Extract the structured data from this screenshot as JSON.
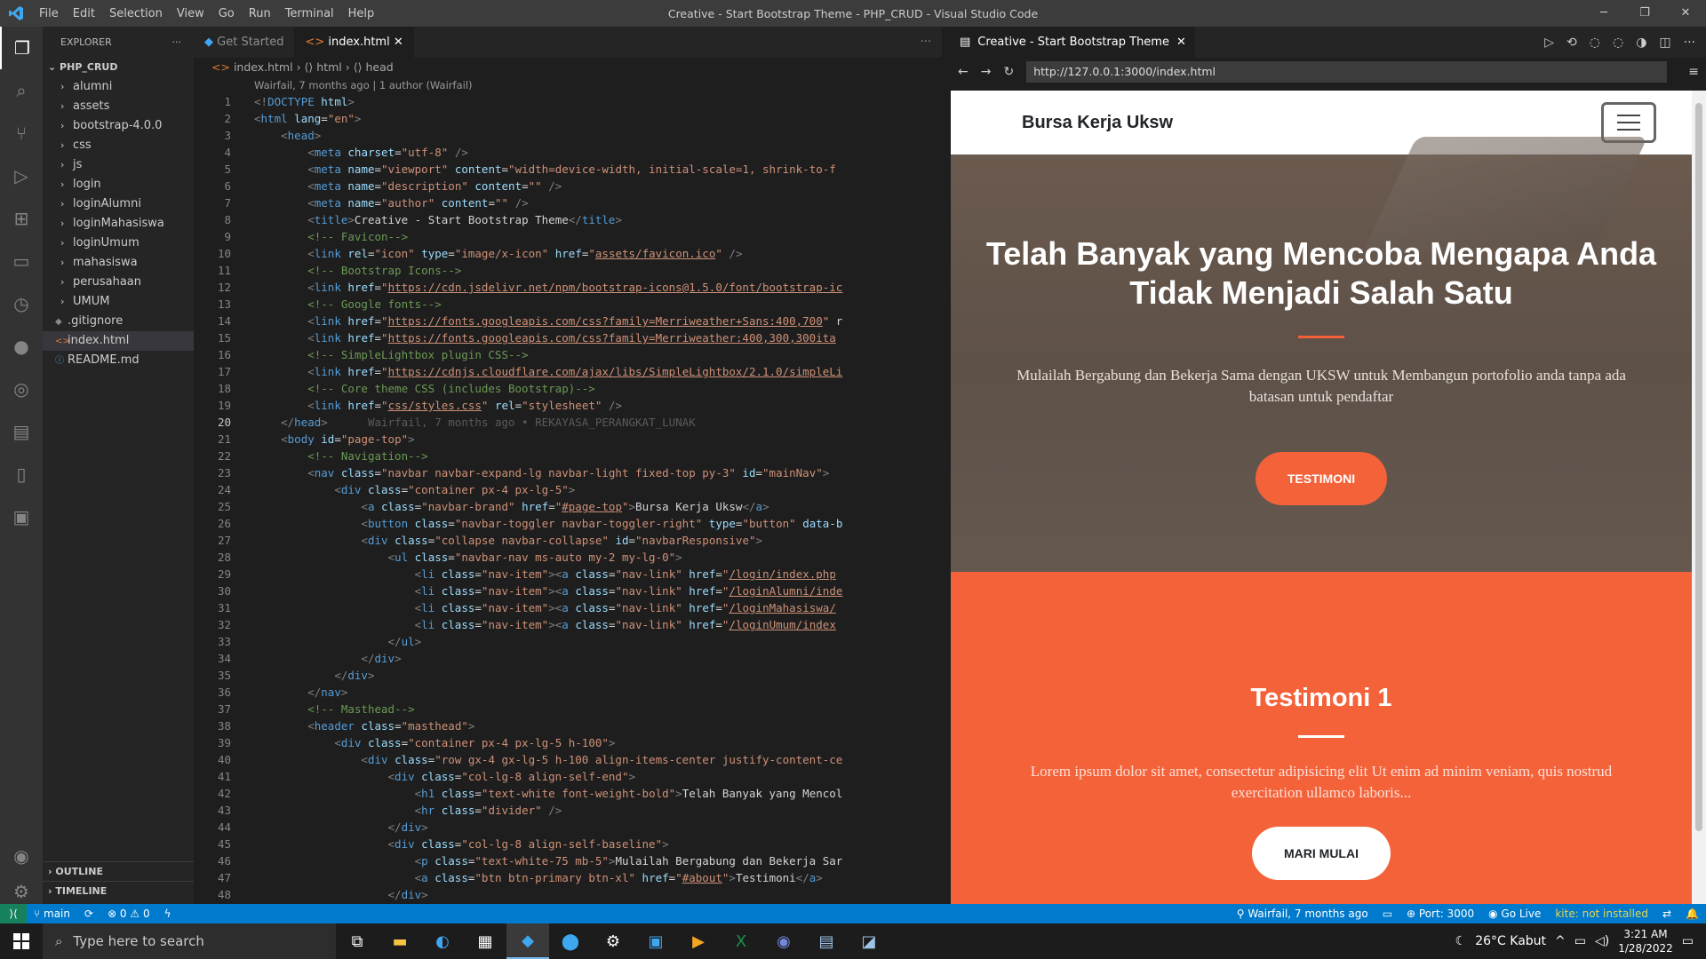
{
  "titlebar": {
    "menu": [
      "File",
      "Edit",
      "Selection",
      "View",
      "Go",
      "Run",
      "Terminal",
      "Help"
    ],
    "title": "Creative - Start Bootstrap Theme - PHP_CRUD - Visual Studio Code"
  },
  "sidebar": {
    "header": "EXPLORER",
    "root": "PHP_CRUD",
    "folders": [
      "alumni",
      "assets",
      "bootstrap-4.0.0",
      "css",
      "js",
      "login",
      "loginAlumni",
      "loginMahasiswa",
      "loginUmum",
      "mahasiswa",
      "perusahaan",
      "UMUM"
    ],
    "files": [
      ".gitignore",
      "index.html",
      "README.md"
    ],
    "outline": "OUTLINE",
    "timeline": "TIMELINE"
  },
  "editor": {
    "tabs": [
      "Get Started",
      "index.html"
    ],
    "breadcrumb": [
      "index.html",
      "html",
      "head"
    ],
    "blame": "Wairfail, 7 months ago | 1 author (Wairfail)",
    "inline_blame": "Wairfail, 7 months ago • REKAYASA_PERANGKAT_LUNAK",
    "current_line": 20,
    "first_line": 1,
    "line_count": 48
  },
  "preview": {
    "tab": "Creative - Start Bootstrap Theme",
    "url": "http://127.0.0.1:3000/index.html",
    "brand": "Bursa Kerja Uksw",
    "hero_title": "Telah Banyak yang Mencoba Mengapa Anda Tidak Menjadi Salah Satu",
    "hero_text": "Mulailah Bergabung dan Bekerja Sama dengan UKSW untuk Membangun portofolio anda tanpa ada batasan untuk pendaftar",
    "hero_button": "TESTIMONI",
    "section_title": "Testimoni 1",
    "section_text": "Lorem ipsum dolor sit amet, consectetur adipisicing elit Ut enim ad minim veniam, quis nostrud exercitation ullamco laboris...",
    "section_button": "MARI MULAI"
  },
  "statusbar": {
    "branch": "main",
    "problems": "⊗ 0 ⚠ 0",
    "blame": "Wairfail, 7 months ago",
    "port": "Port: 3000",
    "golive": "Go Live",
    "kite": "kite: not installed"
  },
  "taskbar": {
    "search_placeholder": "Type here to search",
    "weather": "26°C  Kabut",
    "time": "3:21 AM",
    "date": "1/28/2022"
  },
  "colors": {
    "accent": "#007acc",
    "primary": "#f4623a"
  }
}
